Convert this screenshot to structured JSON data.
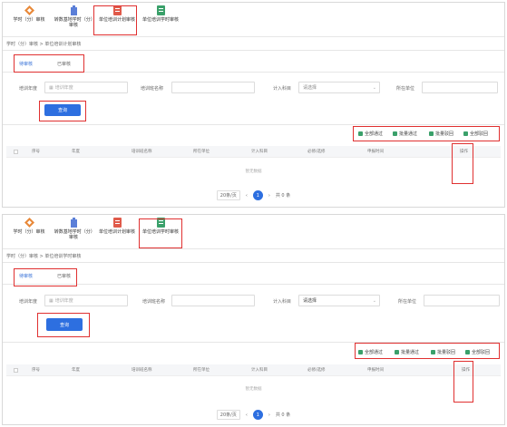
{
  "nav": {
    "item1": "学时（分）审核",
    "item2": "转数基地学时（分）审核",
    "item3": "单位培训计划审核",
    "item4": "单位培训学时审核"
  },
  "panel1": {
    "breadcrumb": "学时（分）审核  >  单位培训计划审核",
    "tab_pending": "待审核",
    "tab_reviewed": "已审核",
    "field_year_label": "培训年度",
    "field_year_placeholder": "培训年度",
    "field_class_label": "培训班名称",
    "field_subject_label": "计入科目",
    "field_subject_value": "请选择",
    "field_unit_label": "所在单位",
    "query_button": "查询",
    "actions": {
      "all_pass": "全部通过",
      "batch_pass": "批量通过",
      "batch_reject": "批量驳回",
      "all_reject": "全部驳回"
    },
    "columns": [
      "序号",
      "年度",
      "培训班名称",
      "所在单位",
      "计入科目",
      "必修/选修",
      "申报时间",
      "操作"
    ],
    "empty_text": "暂无数据",
    "pager": {
      "size": "20条/页",
      "page": "1",
      "total": "共 0 条"
    }
  },
  "panel2": {
    "breadcrumb": "学时（分）审核  >  单位培训学时审核",
    "tab_pending": "待审核",
    "tab_reviewed": "已审核",
    "field_year_label": "培训年度",
    "field_year_placeholder": "培训年度",
    "field_class_label": "培训班名称",
    "field_subject_label": "计入科目",
    "field_subject_value": "请选择",
    "field_unit_label": "所在单位",
    "query_button": "查询",
    "actions": {
      "all_pass": "全部通过",
      "batch_pass": "批量通过",
      "batch_reject": "批量驳回",
      "all_reject": "全部驳回"
    },
    "columns": [
      "序号",
      "年度",
      "培训班名称",
      "所在单位",
      "计入科目",
      "必修/选修",
      "申报时间",
      "操作"
    ],
    "empty_text": "暂无数据",
    "pager": {
      "size": "20条/页",
      "page": "1",
      "total": "共 0 条"
    }
  },
  "colors": {
    "accent": "#2d6fe0",
    "highlight": "#e03030",
    "nav_red": "#e05a4a",
    "nav_green": "#3aa06a",
    "nav_orange": "#e8893a",
    "nav_blue": "#5b7fd8"
  }
}
